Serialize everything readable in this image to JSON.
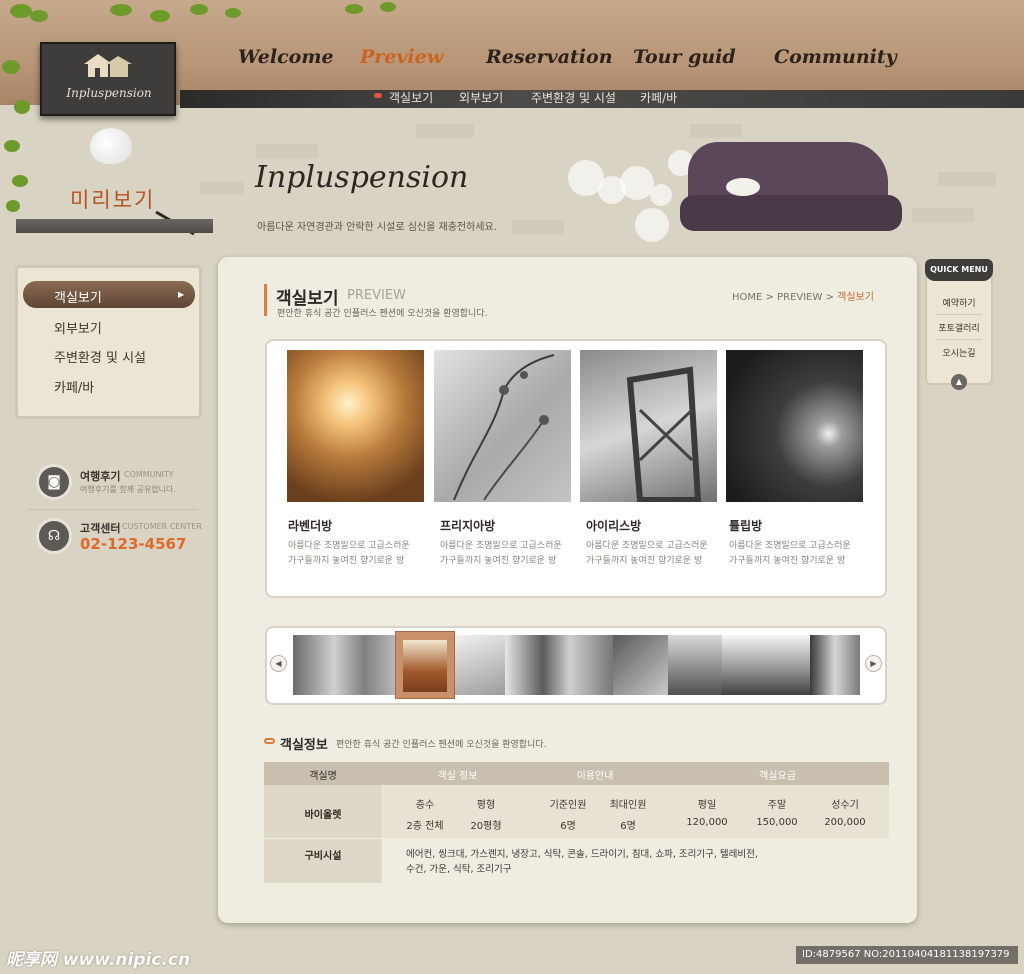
{
  "brand": {
    "logo_text": "Inpluspension"
  },
  "gnb": [
    "Welcome",
    "Preview",
    "Reservation",
    "Tour guid",
    "Community"
  ],
  "subnav": [
    "객실보기",
    "외부보기",
    "주변환경 및 시설",
    "카페/바"
  ],
  "visual": {
    "title": "Inpluspension",
    "desc": "아름다운 자연경관과 안락한 시설로 심신을 재충전하세요."
  },
  "section_title": "미리보기",
  "lnb": [
    "객실보기",
    "외부보기",
    "주변환경 및 시설",
    "카페/바"
  ],
  "contact": {
    "review_title": "여행후기",
    "review_en": "COMMUNITY",
    "review_desc": "여행후기를 함께 공유합니다.",
    "cs_title": "고객센터",
    "cs_en": "CUSTOMER CENTER",
    "phone": "02-123-4567"
  },
  "page": {
    "title": "객실보기",
    "title_en": "PREVIEW",
    "desc": "편안한 휴식 공간 인플러스 펜션에 오신것을 환영합니다.",
    "breadcrumb": {
      "home": "HOME",
      "section": "PREVIEW",
      "current": "객실보기"
    }
  },
  "rooms": [
    {
      "name": "라벤더방",
      "desc1": "아름다운 조명밑으로 고급스러운",
      "desc2": "가구들까지 놓여진 향기로운 방"
    },
    {
      "name": "프리지아방",
      "desc1": "아름다운 조명밑으로 고급스러운",
      "desc2": "가구들까지 놓여진 향기로운 방"
    },
    {
      "name": "아이리스방",
      "desc1": "아름다운 조명밑으로 고급스러운",
      "desc2": "가구들까지 놓여진 향기로운 방"
    },
    {
      "name": "튤립방",
      "desc1": "아름다운 조명밑으로 고급스러운",
      "desc2": "가구들까지 놓여진 향기로운 방"
    }
  ],
  "info": {
    "title": "객실정보",
    "desc": "편안한 휴식 공간 인플러스 펜션에 오신것을 환영합니다.",
    "headers": [
      "객실명",
      "객실 정보",
      "이용안내",
      "객실요금"
    ],
    "room_name": "바이올렛",
    "sub_headers": [
      "층수",
      "평형",
      "기준인원",
      "최대인원",
      "평일",
      "주말",
      "성수기"
    ],
    "values": [
      "2층 전체",
      "20평형",
      "6명",
      "6명",
      "120,000",
      "150,000",
      "200,000"
    ],
    "amenities_label": "구비시설",
    "amenities_line1": "에어컨, 씽크대, 가스렌지, 냉장고, 식탁, 콘솔, 드라이기, 침대, 쇼파, 조리기구, 텔레비전,",
    "amenities_line2": "수건, 가운, 식탁, 조리기구"
  },
  "quick_menu": {
    "title": "QUICK MENU",
    "items": [
      "예약하기",
      "포토갤러리",
      "오시는길"
    ]
  },
  "watermark": {
    "left": "昵享网 www.nipic.cn",
    "right": "ID:4879567 NO:20110404181138197379"
  },
  "colors": {
    "accent": "#c9641f",
    "phone": "#e06a28",
    "lnb_active": "#6b5140",
    "table_head": "#c9bfae"
  }
}
